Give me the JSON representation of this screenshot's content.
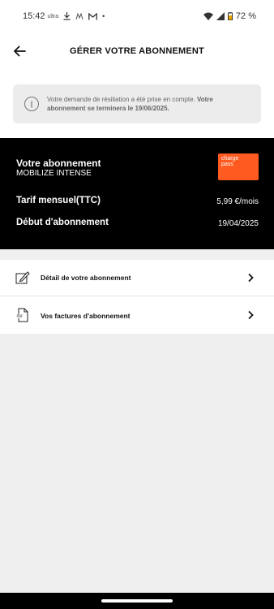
{
  "status_bar": {
    "time": "15:42",
    "tiny_label": "ultra",
    "battery": "72 %"
  },
  "header": {
    "title": "GÉRER VOTRE ABONNEMENT"
  },
  "notice": {
    "text_normal": "Votre demande de résiliation a été prise en compte.",
    "text_bold": "Votre abonnement se terminera le 19/06/2025."
  },
  "subscription": {
    "title": "Votre abonnement",
    "name": "MOBILIZE INTENSE",
    "logo_line1": "charge",
    "logo_line2": "pass",
    "logo_color": "#ff5a1f",
    "tarif_label": "Tarif mensuel(TTC)",
    "tarif_value": "5,99 €/mois",
    "start_label": "Début d'abonnement",
    "start_value": "19/04/2025"
  },
  "menu": {
    "items": [
      {
        "label": "Détail de votre abonnement",
        "icon": "edit-document-icon"
      },
      {
        "label": "Vos factures d'abonnement",
        "icon": "pdf-file-icon"
      }
    ]
  }
}
